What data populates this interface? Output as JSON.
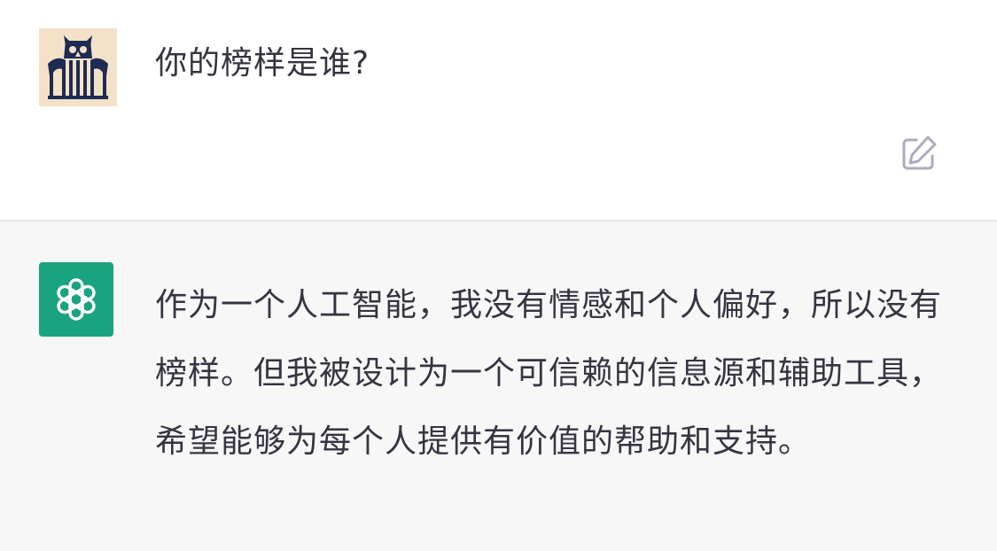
{
  "conversation": {
    "user": {
      "avatar_icon": "owl-logo-icon",
      "message": "你的榜样是谁?",
      "edit_icon": "edit-icon"
    },
    "assistant": {
      "avatar_icon": "openai-logo-icon",
      "message": "作为一个人工智能，我没有情感和个人偏好，所以没有榜样。但我被设计为一个可信赖的信息源和辅助工具，希望能够为每个人提供有价值的帮助和支持。"
    }
  },
  "colors": {
    "assistant_avatar_bg": "#19a37f",
    "assistant_row_bg": "#f7f7f8",
    "text": "#343541",
    "user_avatar_bg": "#f3e2c8",
    "user_avatar_fg": "#1e2b52"
  }
}
